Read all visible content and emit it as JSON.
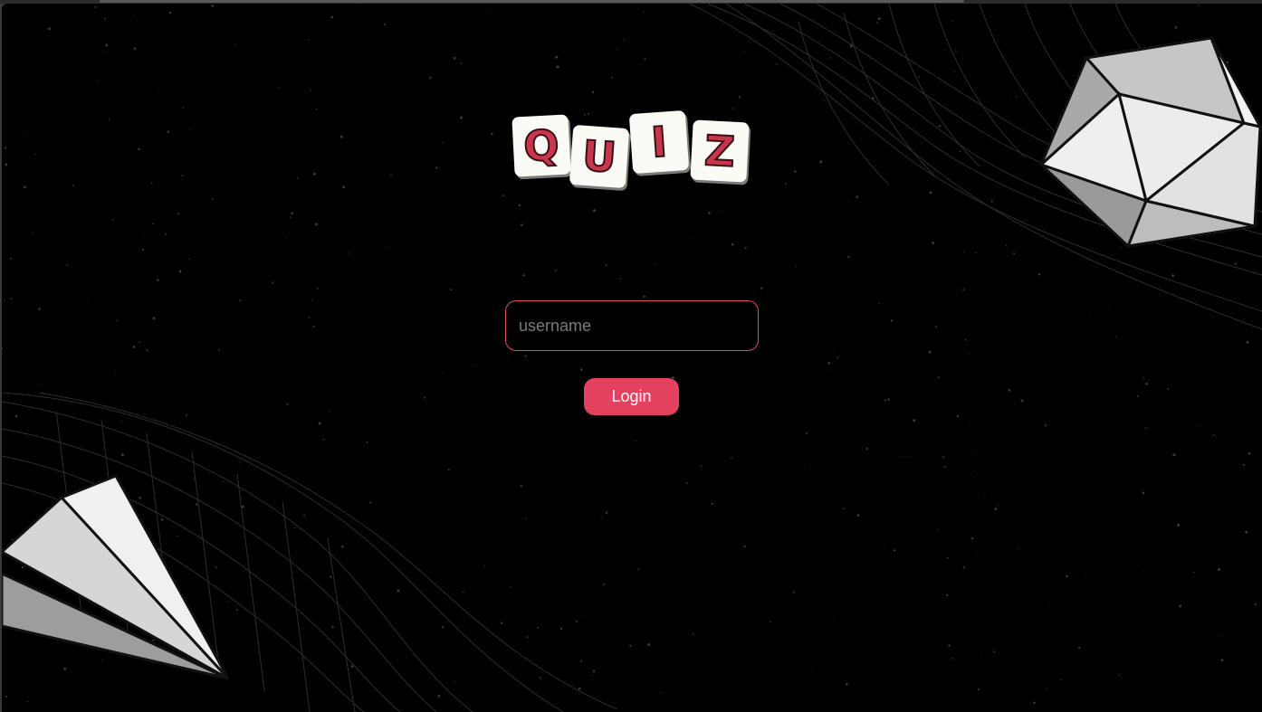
{
  "logo": {
    "letters": [
      "Q",
      "U",
      "I",
      "Z"
    ],
    "tile_color": "#fbfbf6",
    "letter_color": "#c8364c"
  },
  "login_form": {
    "username_placeholder": "username",
    "username_value": "",
    "login_label": "Login"
  },
  "colors": {
    "background": "#000000",
    "accent": "#e3425f"
  },
  "icons": {
    "top_right": "icosahedron-icon",
    "bottom_left": "paper-plane-icon"
  }
}
